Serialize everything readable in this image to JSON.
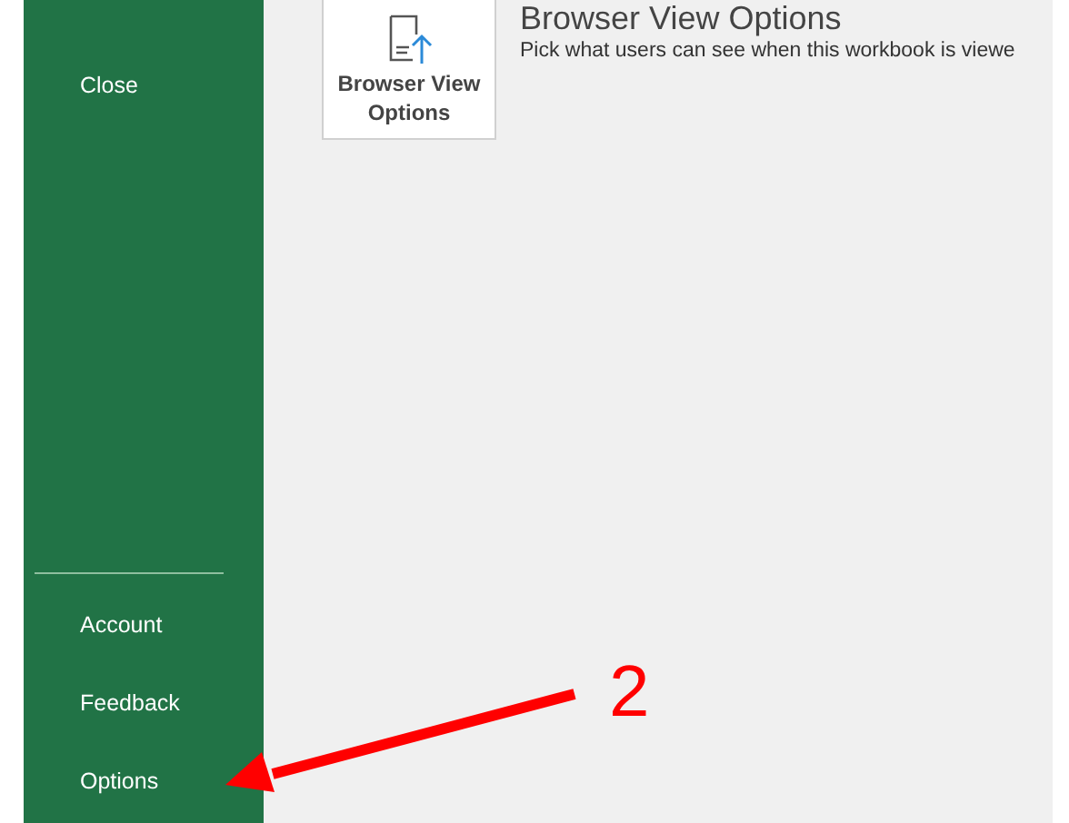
{
  "sidebar": {
    "top_items": [
      {
        "label": "Close",
        "selected": false
      }
    ],
    "bottom_items": [
      {
        "label": "Account",
        "selected": false
      },
      {
        "label": "Feedback",
        "selected": false
      },
      {
        "label": "Options",
        "selected": false
      }
    ]
  },
  "content": {
    "button": {
      "label": "Browser View Options"
    },
    "heading": "Browser View Options",
    "description": "Pick what users can see when this workbook is viewe"
  },
  "annotation": {
    "label": "2"
  }
}
